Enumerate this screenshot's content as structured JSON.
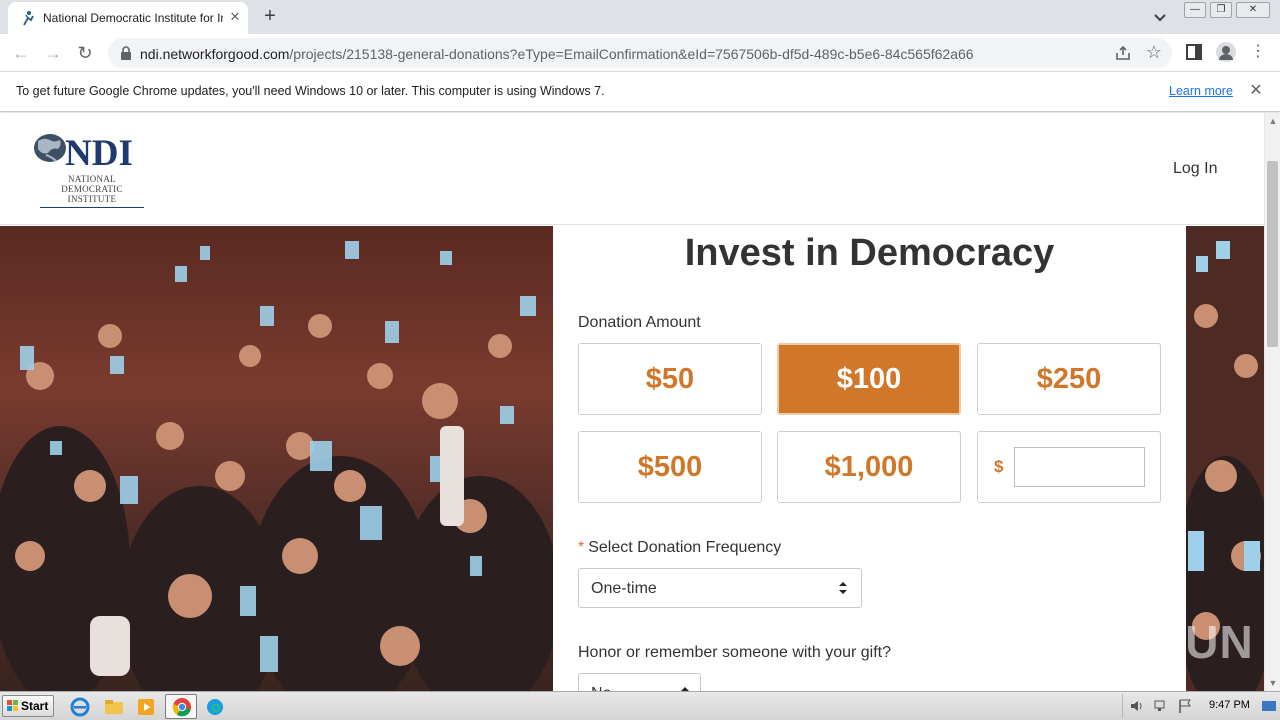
{
  "browser": {
    "tab": {
      "title": "National Democratic Institute for Int",
      "close_glyph": "✕"
    },
    "new_tab_glyph": "+",
    "window_controls": {
      "minimize": "—",
      "restore": "❐",
      "close": "✕"
    },
    "toolbar": {
      "back_glyph": "←",
      "forward_glyph": "→",
      "reload_glyph": "↻",
      "url_host": "ndi.networkforgood.com",
      "url_path": "/projects/215138-general-donations?eType=EmailConfirmation&eId=7567506b-df5d-489c-b5e6-84c565f62a66",
      "star_glyph": "☆",
      "menu_glyph": "⋮"
    },
    "infobar": {
      "message": "To get future Google Chrome updates, you'll need Windows 10 or later. This computer is using Windows 7.",
      "link": "Learn more",
      "close_glyph": "✕"
    }
  },
  "site": {
    "logo": {
      "mark": "NDI",
      "subtitle_lines": [
        "NATIONAL",
        "DEMOCRATIC",
        "INSTITUTE"
      ],
      "brand_color": "#1f3a6e"
    },
    "nav": {
      "login": "Log In"
    }
  },
  "form": {
    "title": "Invest in Democracy",
    "amount_label": "Donation Amount",
    "amounts": [
      {
        "label": "$50",
        "selected": false
      },
      {
        "label": "$100",
        "selected": true
      },
      {
        "label": "$250",
        "selected": false
      },
      {
        "label": "$500",
        "selected": false
      },
      {
        "label": "$1,000",
        "selected": false
      }
    ],
    "custom_amount": {
      "currency": "$",
      "value": ""
    },
    "frequency": {
      "required_mark": "*",
      "label": "Select Donation Frequency",
      "value": "One-time"
    },
    "honor": {
      "label": "Honor or remember someone with your gift?",
      "value": "No"
    },
    "accent_color": "#d0772a"
  },
  "watermark": "ANY RUN",
  "taskbar": {
    "start": "Start",
    "clock": "9:47 PM"
  }
}
